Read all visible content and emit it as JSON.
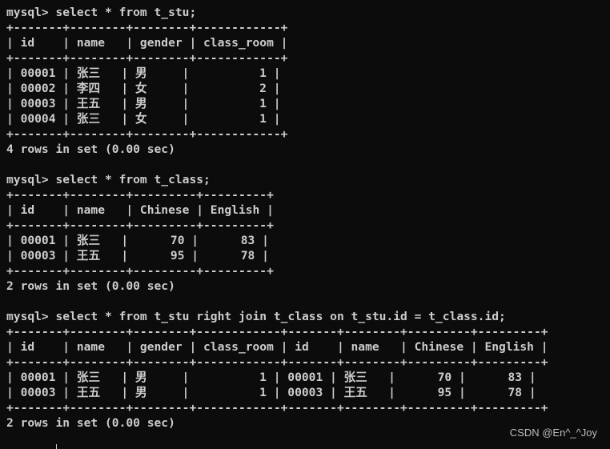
{
  "terminal": {
    "lines": [
      "mysql> select * from t_stu;",
      "+-------+--------+--------+------------+",
      "| id    | name   | gender | class_room |",
      "+-------+--------+--------+------------+",
      "| 00001 | 张三   | 男     |          1 |",
      "| 00002 | 李四   | 女     |          2 |",
      "| 00003 | 王五   | 男     |          1 |",
      "| 00004 | 张三   | 女     |          1 |",
      "+-------+--------+--------+------------+",
      "4 rows in set (0.00 sec)",
      "",
      "mysql> select * from t_class;",
      "+-------+--------+---------+---------+",
      "| id    | name   | Chinese | English |",
      "+-------+--------+---------+---------+",
      "| 00001 | 张三   |      70 |      83 |",
      "| 00003 | 王五   |      95 |      78 |",
      "+-------+--------+---------+---------+",
      "2 rows in set (0.00 sec)",
      "",
      "mysql> select * from t_stu right join t_class on t_stu.id = t_class.id;",
      "+-------+--------+--------+------------+-------+--------+---------+---------+",
      "| id    | name   | gender | class_room | id    | name   | Chinese | English |",
      "+-------+--------+--------+------------+-------+--------+---------+---------+",
      "| 00001 | 张三   | 男     |          1 | 00001 | 张三   |      70 |      83 |",
      "| 00003 | 王五   | 男     |          1 | 00003 | 王五   |      95 |      78 |",
      "+-------+--------+--------+------------+-------+--------+---------+---------+",
      "2 rows in set (0.00 sec)",
      ""
    ]
  },
  "watermark": "CSDN @En^_^Joy"
}
